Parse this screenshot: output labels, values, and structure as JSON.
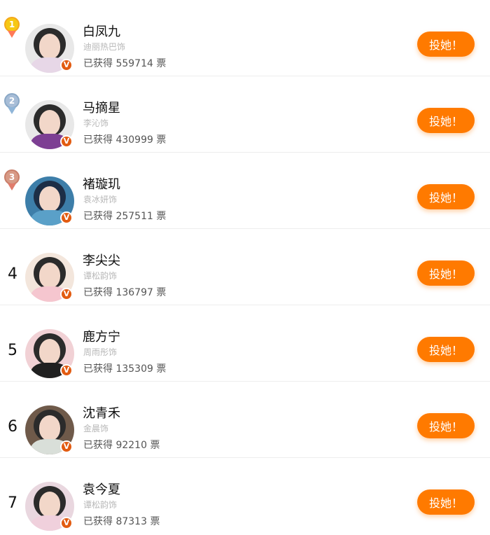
{
  "colors": {
    "accent": "#ff7a00",
    "gold": "#f6c814",
    "silver": "#a7bdd7",
    "bronze": "#d79a86",
    "v_badge": "#e25b11"
  },
  "ranking": [
    {
      "rank": "1",
      "medal": "gold",
      "name": "白凤九",
      "actor": "迪丽热巴饰",
      "votes_prefix": "已获得",
      "votes": "559714",
      "votes_suffix": "票",
      "button": "投她！"
    },
    {
      "rank": "2",
      "medal": "silver",
      "name": "马摘星",
      "actor": "李沁饰",
      "votes_prefix": "已获得",
      "votes": "430999",
      "votes_suffix": "票",
      "button": "投她！"
    },
    {
      "rank": "3",
      "medal": "bronze",
      "name": "褚璇玑",
      "actor": "袁冰妍饰",
      "votes_prefix": "已获得",
      "votes": "257511",
      "votes_suffix": "票",
      "button": "投她！"
    },
    {
      "rank": "4",
      "medal": "",
      "name": "李尖尖",
      "actor": "谭松韵饰",
      "votes_prefix": "已获得",
      "votes": "136797",
      "votes_suffix": "票",
      "button": "投她！"
    },
    {
      "rank": "5",
      "medal": "",
      "name": "鹿方宁",
      "actor": "周雨彤饰",
      "votes_prefix": "已获得",
      "votes": "135309",
      "votes_suffix": "票",
      "button": "投她！"
    },
    {
      "rank": "6",
      "medal": "",
      "name": "沈青禾",
      "actor": "金晨饰",
      "votes_prefix": "已获得",
      "votes": "92210",
      "votes_suffix": "票",
      "button": "投她！"
    },
    {
      "rank": "7",
      "medal": "",
      "name": "袁今夏",
      "actor": "谭松韵饰",
      "votes_prefix": "已获得",
      "votes": "87313",
      "votes_suffix": "票",
      "button": "投她！"
    }
  ]
}
